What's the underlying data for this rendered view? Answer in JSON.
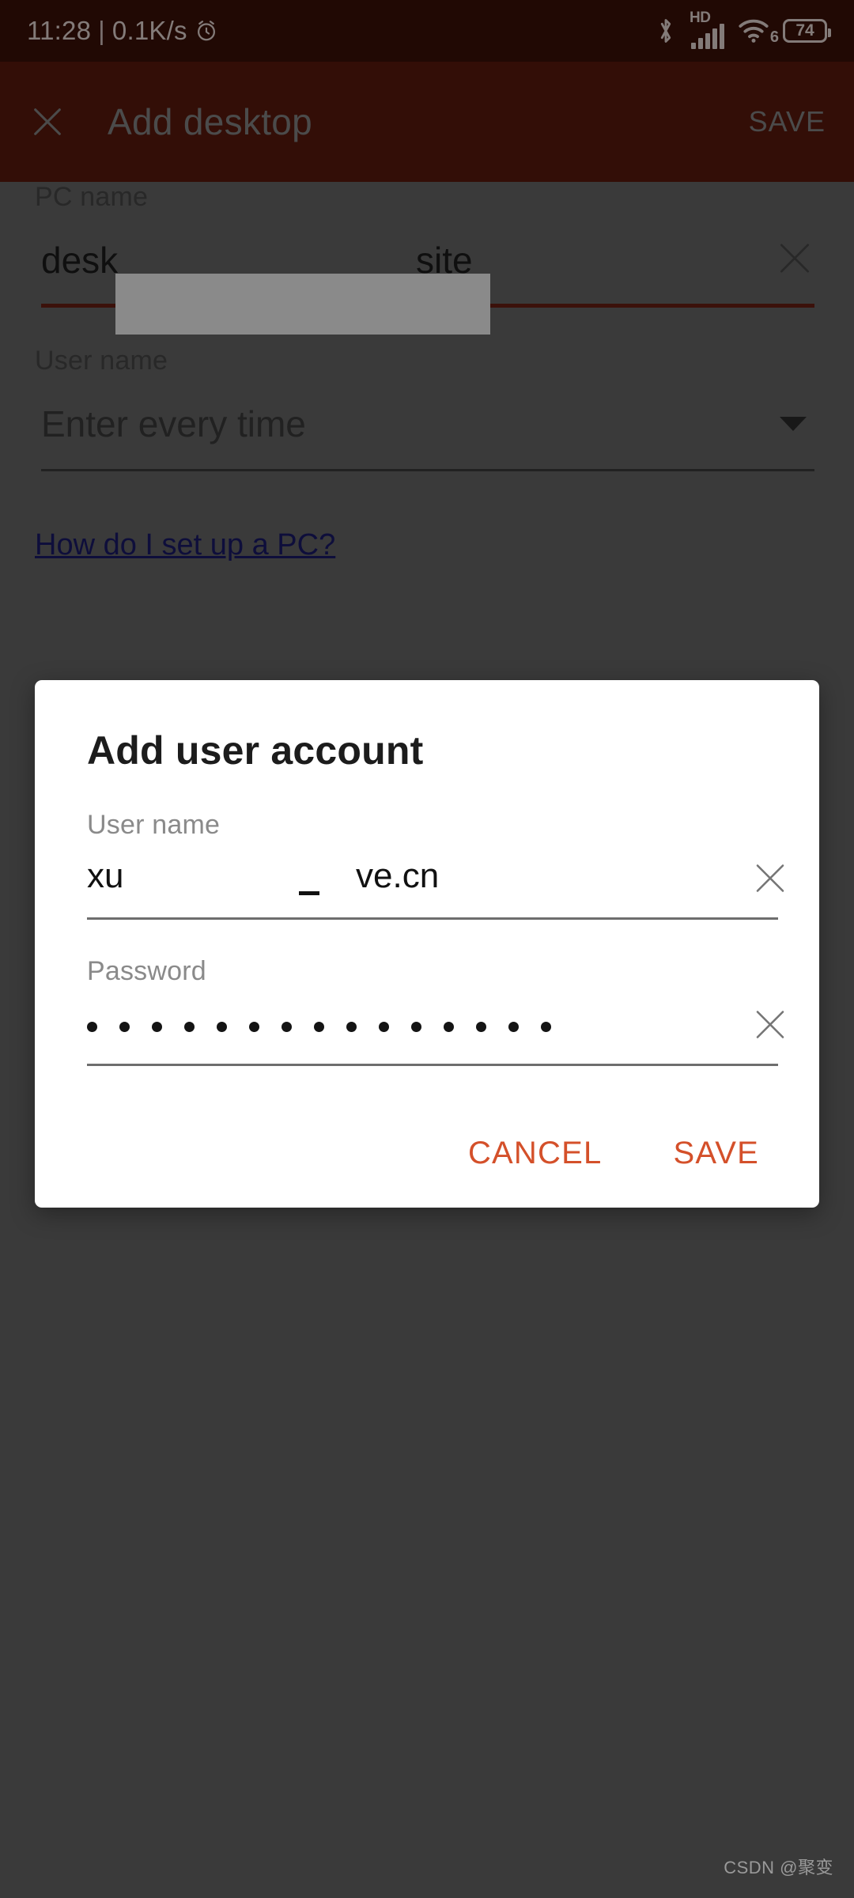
{
  "status_bar": {
    "time": "11:28",
    "separator": "|",
    "network_speed": "0.1K/s",
    "alarm_icon": "alarm-clock-icon",
    "bluetooth_icon": "bluetooth-icon",
    "hd_label": "HD",
    "signal_icon": "cellular-signal-icon",
    "wifi_icon": "wifi-icon",
    "wifi_generation": "6",
    "battery_level": "74",
    "background_color": "#3d1109",
    "foreground_color": "#f3e3e0"
  },
  "app_bar": {
    "close_icon": "close-icon",
    "title": "Add desktop",
    "save_label": "SAVE",
    "background_color": "#5e1b0e",
    "text_color": "#8b8b8b"
  },
  "form": {
    "pc_name": {
      "label": "PC name",
      "value_start": "desk",
      "value_end": "site",
      "redacted": true,
      "clear_icon": "close-icon",
      "underline_color": "#6e2013"
    },
    "user_name": {
      "label": "User name",
      "value": "Enter every time",
      "caret_icon": "chevron-down-icon",
      "underline_color": "#3d3d3d"
    },
    "help_link": "How do I set up a PC?",
    "help_link_color": "#1a1a6e"
  },
  "dialog": {
    "title": "Add user account",
    "user_name": {
      "label": "User name",
      "value_start": "xu",
      "value_end": "ve.cn",
      "redacted": true,
      "clear_icon": "close-icon"
    },
    "password": {
      "label": "Password",
      "masked_value": "•••••••••••••••",
      "dot_count": 15,
      "clear_icon": "close-icon"
    },
    "cancel_label": "CANCEL",
    "save_label": "SAVE",
    "action_color": "#d4502a",
    "background_color": "#ffffff"
  },
  "watermark": "CSDN @聚变",
  "scrim_color": "rgba(0,0,0,0.46)"
}
